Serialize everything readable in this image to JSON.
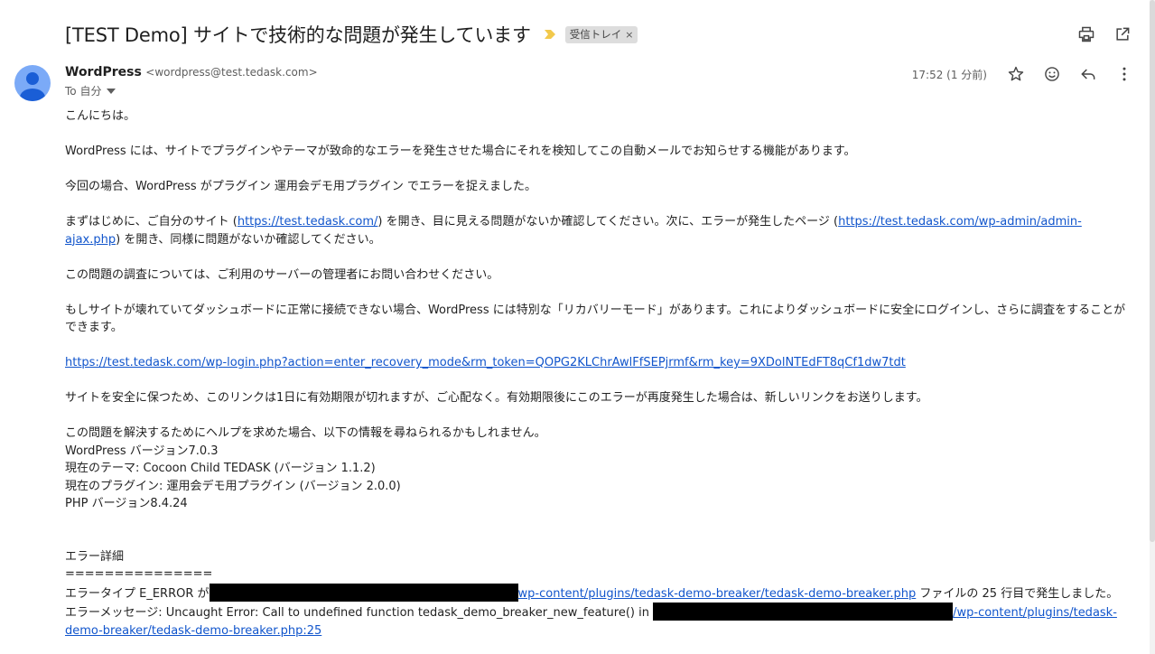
{
  "subject": "[TEST Demo] サイトで技術的な問題が発生しています",
  "label_chip": "受信トレイ",
  "label_chip_remove": "×",
  "sender": {
    "name": "WordPress",
    "email": "<wordpress@test.tedask.com>",
    "to": "To 自分"
  },
  "time": "17:52 (1 分前)",
  "icons": {
    "print": "print-icon",
    "open_new_window": "open-in-new-icon",
    "star": "star-icon",
    "emoji": "emoji-icon",
    "reply": "reply-icon",
    "more": "more-vert-icon",
    "importance": "importance-marker-icon",
    "avatar": "default-avatar-icon"
  },
  "colors": {
    "link": "#1155cc",
    "importance": "#f2c94c",
    "avatar_bg": "#7baaf7",
    "chip_bg": "#dddddd"
  },
  "body": {
    "greeting": "こんにちは。",
    "p1": "WordPress には、サイトでプラグインやテーマが致命的なエラーを発生させた場合にそれを検知してこの自動メールでお知らせする機能があります。",
    "p2": "今回の場合、WordPress がプラグイン 運用会デモ用プラグイン でエラーを捉えました。",
    "p3_a": "まずはじめに、ご自分のサイト (",
    "p3_link1": "https://test.tedask.com/",
    "p3_b": ") を開き、目に見える問題がないか確認してください。次に、エラーが発生したページ (",
    "p3_link2": "https://test.tedask.com/wp-admin/admin-ajax.php",
    "p3_c": ") を開き、同様に問題がないか確認してください。",
    "p4": "この問題の調査については、ご利用のサーバーの管理者にお問い合わせください。",
    "p5": "もしサイトが壊れていてダッシュボードに正常に接続できない場合、WordPress には特別な「リカバリーモード」があります。これによりダッシュボードに安全にログインし、さらに調査をすることができます。",
    "recovery_link": "https://test.tedask.com/wp-login.php?action=enter_recovery_mode&rm_token=QOPG2KLChrAwlFfSEPjrmf&rm_key=9XDolNTEdFT8qCf1dw7tdt",
    "p6": "サイトを安全に保つため、このリンクは1日に有効期限が切れますが、ご心配なく。有効期限後にこのエラーが再度発生した場合は、新しいリンクをお送りします。",
    "p7": "この問題を解決するためにヘルプを求めた場合、以下の情報を尋ねられるかもしれません。",
    "info_wp": "WordPress バージョン7.0.3",
    "info_theme": "現在のテーマ: Cocoon Child TEDASK (バージョン 1.1.2)",
    "info_plugin": "現在のプラグイン: 運用会デモ用プラグイン (バージョン 2.0.0)",
    "info_php": "PHP バージョン8.4.24",
    "error_heading": "エラー詳細",
    "error_rule": "===============",
    "error_a": "エラータイプ E_ERROR が",
    "error_link1": "wp-content/plugins/tedask-demo-breaker/tedask-demo-breaker.php",
    "error_b": " ファイルの 25 行目で発生しました。 エラーメッセージ: Uncaught Error: Call to undefined function tedask_demo_breaker_new_feature() in ",
    "error_link2": "/wp-content/plugins/tedask-demo-breaker/tedask-demo-breaker.php:25"
  }
}
